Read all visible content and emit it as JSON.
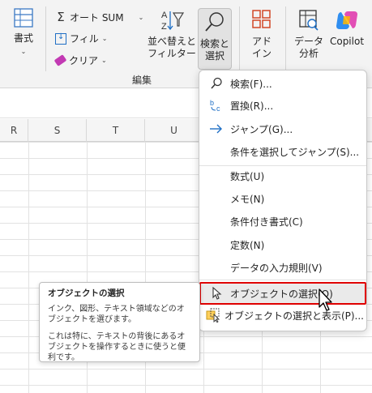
{
  "ribbon": {
    "format_label": "書式",
    "autosum_label": "オート SUM",
    "fill_label": "フィル",
    "clear_label": "クリア",
    "sort_filter_label_1": "並べ替えと",
    "sort_filter_label_2": "フィルター",
    "find_select_label_1": "検索と",
    "find_select_label_2": "選択",
    "addin_label_1": "アド",
    "addin_label_2": "イン",
    "data_analysis_label_1": "データ",
    "data_analysis_label_2": "分析",
    "copilot_label": "Copilot",
    "group_label": "編集"
  },
  "sheet": {
    "columns": [
      "R",
      "S",
      "T",
      "U"
    ]
  },
  "menu": {
    "items": [
      {
        "label": "検索(F)...",
        "icon": "search-icon"
      },
      {
        "label": "置換(R)...",
        "icon": "replace-icon"
      },
      {
        "label": "ジャンプ(G)...",
        "icon": "arrow-right-icon"
      },
      {
        "label": "条件を選択してジャンプ(S)...",
        "icon": ""
      },
      {
        "label": "数式(U)",
        "icon": ""
      },
      {
        "label": "メモ(N)",
        "icon": ""
      },
      {
        "label": "条件付き書式(C)",
        "icon": ""
      },
      {
        "label": "定数(N)",
        "icon": ""
      },
      {
        "label": "データの入力規則(V)",
        "icon": ""
      },
      {
        "label": "オブジェクトの選択(O)",
        "icon": "select-objects-icon"
      },
      {
        "label": "オブジェクトの選択と表示(P)...",
        "icon": "selection-pane-icon"
      }
    ]
  },
  "tooltip": {
    "title": "オブジェクトの選択",
    "para1": "インク、図形、テキスト領域などのオブジェクトを選びます。",
    "para2": "これは特に、テキストの背後にあるオブジェクトを操作するときに使うと便利です。"
  },
  "colors": {
    "highlight_border": "#e00000",
    "accent_blue": "#1f6fc5",
    "addin_orange": "#d24726"
  }
}
